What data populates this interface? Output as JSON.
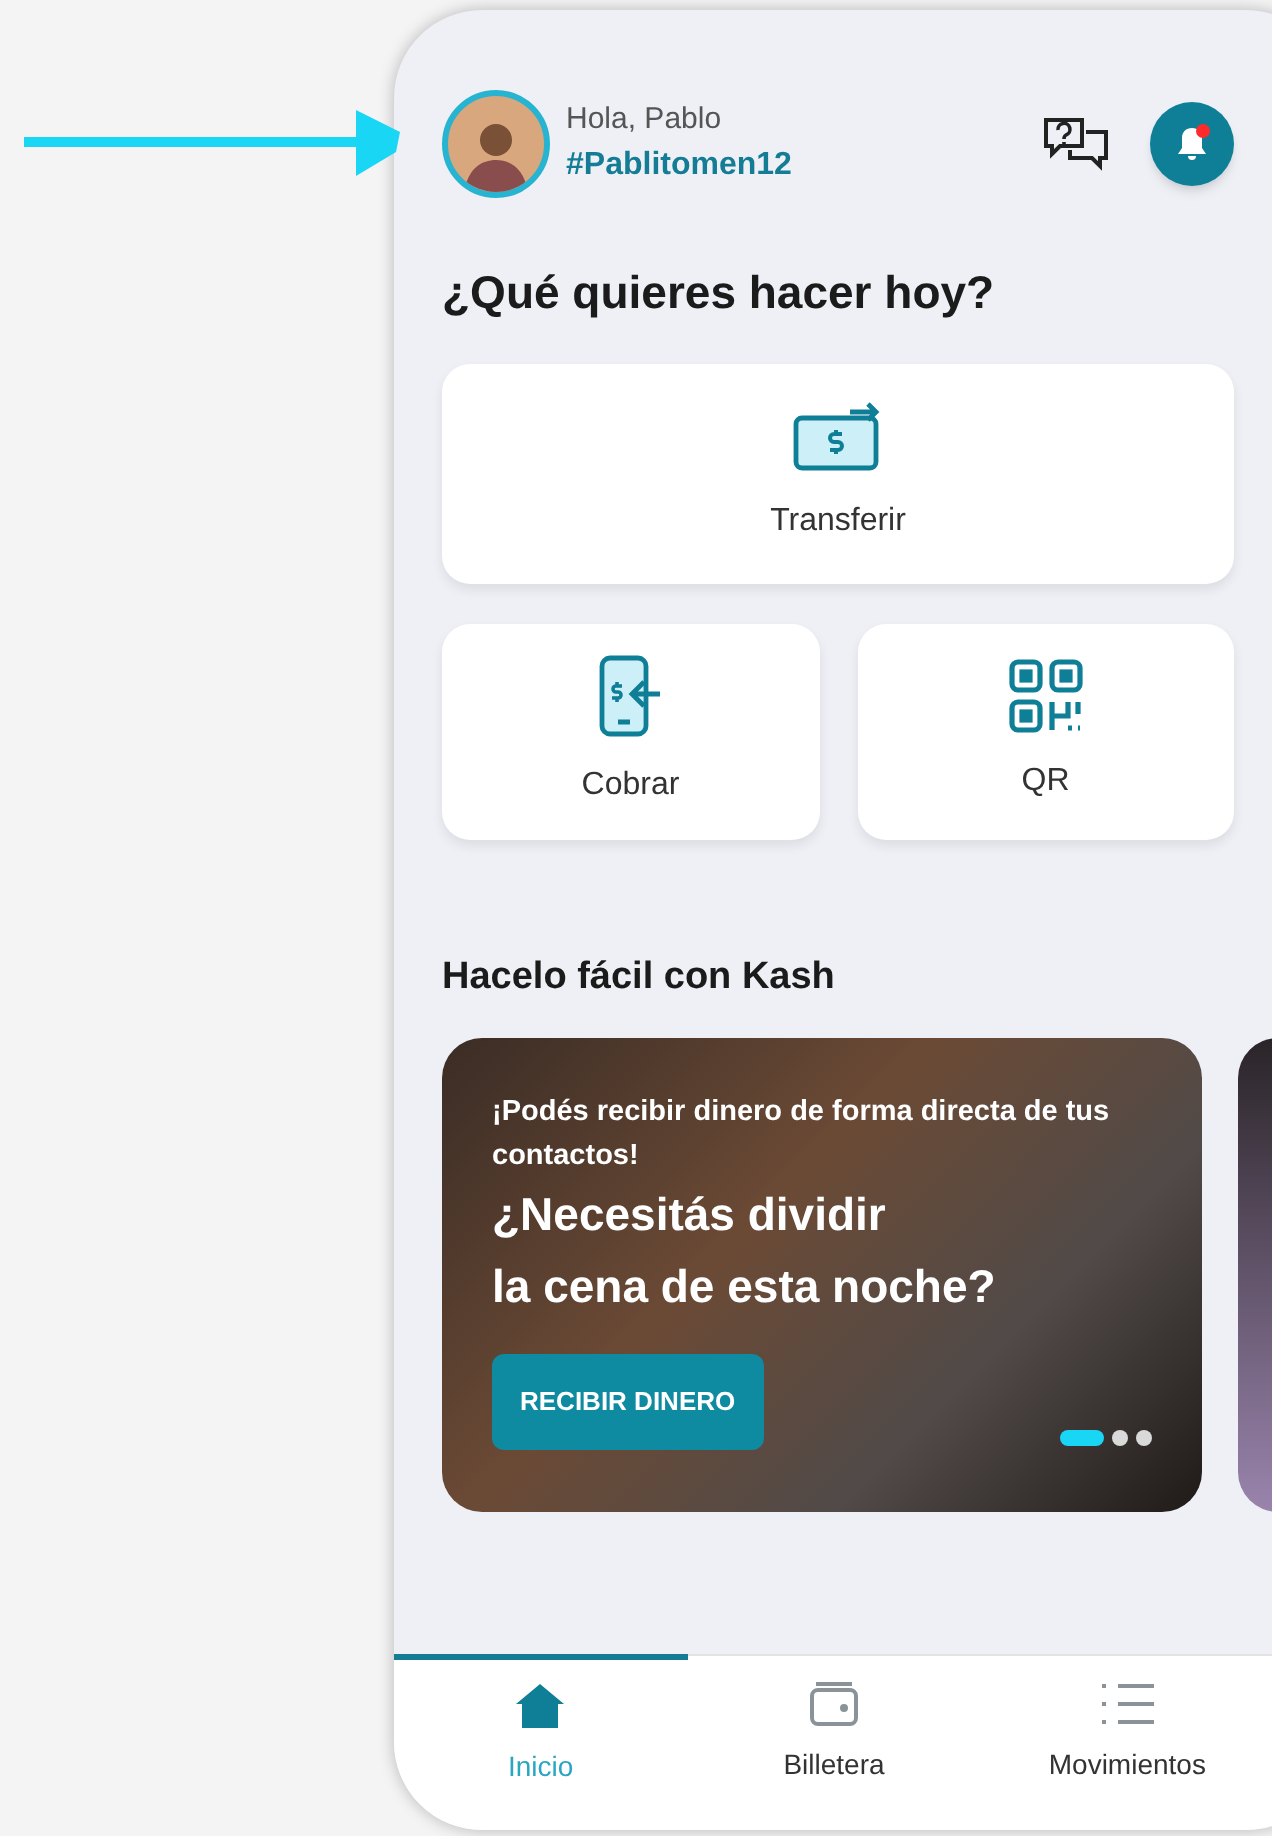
{
  "header": {
    "greeting": "Hola, Pablo",
    "username": "#Pablitomen12",
    "notification_unread": true
  },
  "title": "¿Qué quieres hacer hoy?",
  "actions": [
    {
      "kind": "transfer",
      "label": "Transferir"
    },
    {
      "kind": "charge",
      "label": "Cobrar"
    },
    {
      "kind": "qr",
      "label": "QR"
    }
  ],
  "section_title": "Hacelo fácil con Kash",
  "promo": {
    "subtitle": "¡Podés recibir dinero de forma directa de tus contactos!",
    "headline": [
      "¿Necesitás dividir",
      "la cena de esta noche?"
    ],
    "button": "RECIBIR DINERO",
    "dots": [
      {
        "selected": true
      },
      {
        "selected": false
      },
      {
        "selected": false
      }
    ]
  },
  "nav": [
    {
      "kind": "home",
      "label": "Inicio",
      "selected": true
    },
    {
      "kind": "wallet",
      "label": "Billetera",
      "selected": false
    },
    {
      "kind": "list",
      "label": "Movimientos",
      "selected": false
    }
  ]
}
